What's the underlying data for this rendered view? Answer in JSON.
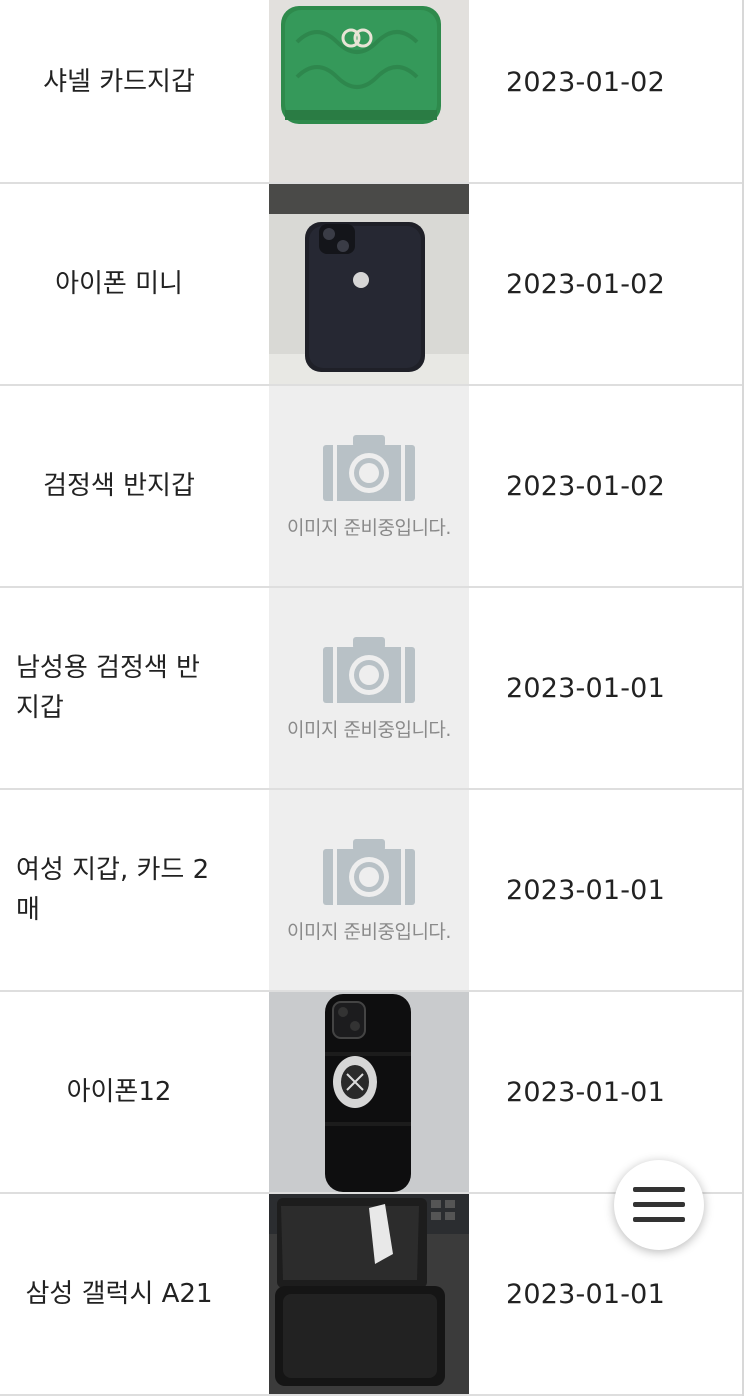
{
  "items": [
    {
      "name": "샤넬 카드지갑",
      "date": "2023-01-02",
      "image": "green-wallet-photo"
    },
    {
      "name": "아이폰 미니",
      "date": "2023-01-02",
      "image": "black-iphone-photo"
    },
    {
      "name": "검정색 반지갑",
      "date": "2023-01-02",
      "image": "placeholder",
      "placeholder_text": "이미지 준비중입니다."
    },
    {
      "name": "남성용 검정색 반지갑",
      "date": "2023-01-01",
      "image": "placeholder",
      "placeholder_text": "이미지 준비중입니다."
    },
    {
      "name": "여성 지갑, 카드 2매",
      "date": "2023-01-01",
      "image": "placeholder",
      "placeholder_text": "이미지 준비중입니다."
    },
    {
      "name": "아이폰12",
      "date": "2023-01-01",
      "image": "iphone-otterbox-case-photo"
    },
    {
      "name": "삼성 갤럭시 A21",
      "date": "2023-01-01",
      "image": "black-wallet-phone-photo"
    }
  ],
  "menu_button": {
    "icon": "hamburger-menu-icon"
  }
}
